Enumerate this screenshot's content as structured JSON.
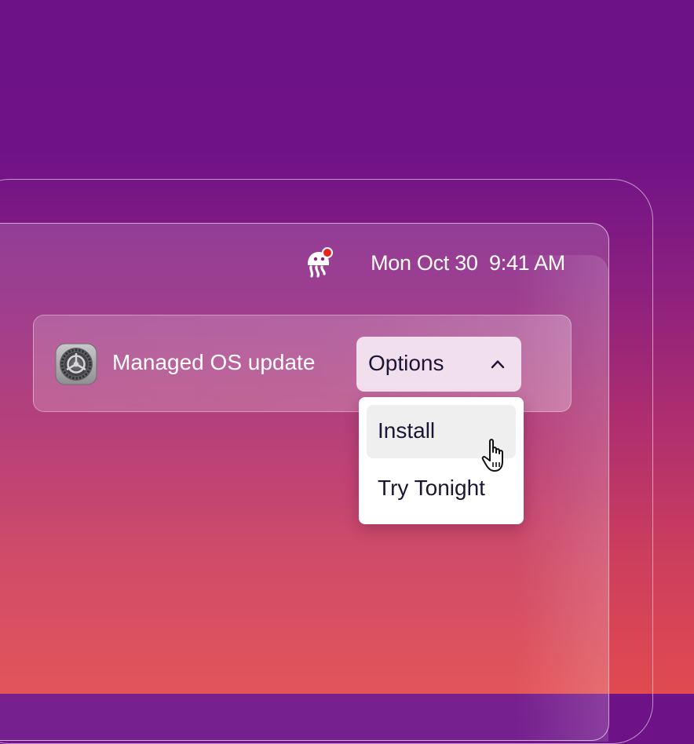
{
  "menubar": {
    "date": "Mon Oct 30",
    "time": "9:41 AM",
    "app_icon": "jellyfish-agent-icon",
    "notification_dot_color": "#e8221f"
  },
  "notification": {
    "icon": "system-settings-gear-icon",
    "title": "Managed OS update",
    "options_button": {
      "label": "Options",
      "icon": "chevron-up-icon",
      "expanded": true
    },
    "menu": {
      "items": [
        {
          "label": "Install",
          "hovered": true
        },
        {
          "label": "Try Tonight",
          "hovered": false
        }
      ]
    }
  },
  "pointer": "hand-pointer-cursor-icon",
  "colors": {
    "background_top": "#6e1287",
    "background_bottom": "#e14a4f",
    "button_fill": "#f1dfee",
    "text_dark": "#1b1633"
  }
}
